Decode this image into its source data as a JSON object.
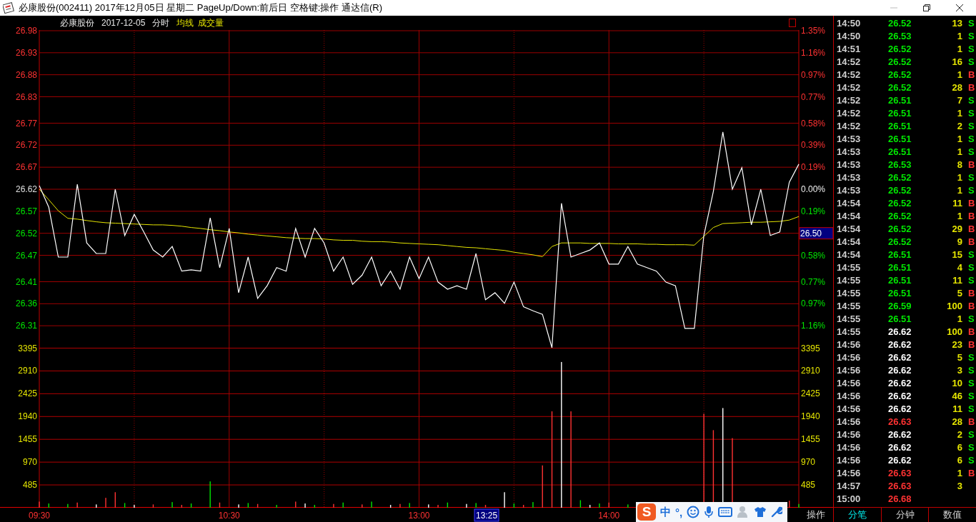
{
  "window": {
    "title": "必康股份(002411) 2017年12月05日 星期二 PageUp/Down:前后日 空格键:操作 通达信(R)"
  },
  "header": {
    "stock": "必康股份",
    "date": "2017-12-05",
    "mode": "分时",
    "indicators": [
      "均线",
      "成交量"
    ]
  },
  "price_chart": {
    "chart_data": {
      "type": "line",
      "grid": true,
      "categories": [
        null,
        null,
        null,
        null,
        null,
        null,
        null,
        null,
        null,
        null,
        null,
        null,
        null,
        null,
        null,
        null,
        null,
        null,
        null,
        null,
        null,
        null,
        null,
        null,
        null,
        null,
        null,
        null,
        null,
        null,
        null,
        null,
        null,
        null,
        null,
        null,
        null,
        null,
        null,
        null,
        null,
        null,
        null,
        null,
        null,
        null,
        null,
        null,
        null,
        null,
        null,
        null,
        null,
        null,
        null,
        null,
        null,
        null,
        null,
        null,
        null,
        null,
        null,
        null,
        null,
        null,
        null,
        null,
        null,
        null,
        null,
        null,
        null,
        null,
        null,
        null,
        null,
        null,
        null,
        null,
        null
      ],
      "series": [
        {
          "color": "#ffffff",
          "values": [
            26.628,
            26.579,
            26.466,
            26.466,
            26.631,
            26.498,
            26.474,
            26.474,
            26.62,
            26.515,
            26.563,
            26.523,
            26.482,
            26.466,
            26.49,
            26.434,
            26.437,
            26.434,
            26.555,
            26.442,
            26.531,
            26.385,
            26.466,
            26.372,
            26.401,
            26.442,
            26.434,
            26.531,
            26.466,
            26.531,
            26.498,
            26.434,
            26.466,
            26.404,
            26.425,
            26.466,
            26.401,
            26.434,
            26.393,
            26.466,
            26.417,
            26.466,
            26.409,
            26.393,
            26.401,
            26.393,
            26.474,
            26.369,
            26.385,
            26.361,
            26.409,
            26.353,
            26.344,
            26.336,
            26.26,
            26.588,
            26.466,
            26.474,
            26.482,
            26.498,
            26.45,
            26.45,
            26.49,
            26.45,
            26.442,
            26.434,
            26.409,
            26.401,
            26.304,
            26.304,
            26.515,
            26.615,
            26.75,
            26.62,
            26.669,
            26.539,
            26.62,
            26.515,
            26.523,
            26.636,
            26.677
          ]
        },
        {
          "color": "#e6e600",
          "values": [
            26.62,
            26.596,
            26.571,
            26.554,
            26.552,
            26.549,
            26.546,
            26.544,
            26.543,
            26.542,
            26.541,
            26.54,
            26.539,
            26.539,
            26.538,
            26.536,
            26.533,
            26.531,
            26.528,
            26.526,
            26.523,
            26.521,
            26.518,
            26.516,
            26.514,
            26.512,
            26.51,
            26.509,
            26.508,
            26.508,
            26.507,
            26.505,
            26.504,
            26.504,
            26.502,
            26.501,
            26.501,
            26.5,
            26.498,
            26.497,
            26.496,
            26.495,
            26.494,
            26.492,
            26.49,
            26.488,
            26.487,
            26.485,
            26.483,
            26.481,
            26.477,
            26.474,
            26.471,
            26.467,
            26.49,
            26.498,
            26.498,
            26.498,
            26.497,
            26.497,
            26.497,
            26.496,
            26.496,
            26.496,
            26.495,
            26.495,
            26.494,
            26.494,
            26.494,
            26.493,
            26.513,
            26.533,
            26.542,
            26.543,
            26.544,
            26.545,
            26.545,
            26.546,
            26.547,
            26.55,
            26.558
          ]
        }
      ],
      "ylim": [
        26.26,
        26.98
      ],
      "yticks": [
        {
          "value": 26.98,
          "label": "26.98"
        },
        {
          "value": 26.93,
          "label": "26.93"
        },
        {
          "value": 26.88,
          "label": "26.88"
        },
        {
          "value": 26.83,
          "label": "26.83"
        },
        {
          "value": 26.77,
          "label": "26.77"
        },
        {
          "value": 26.72,
          "label": "26.72"
        },
        {
          "value": 26.67,
          "label": "26.67"
        },
        {
          "value": 26.62,
          "label": "26.62"
        },
        {
          "value": 26.57,
          "label": "26.57"
        },
        {
          "value": 26.52,
          "label": "26.52"
        },
        {
          "value": 26.47,
          "label": "26.47"
        },
        {
          "value": 26.41,
          "label": "26.41"
        },
        {
          "value": 26.36,
          "label": "26.36"
        },
        {
          "value": 26.31,
          "label": "26.31"
        }
      ]
    },
    "right_labels": [
      {
        "label": "1.35%",
        "kind": "up"
      },
      {
        "label": "1.16%",
        "kind": "up"
      },
      {
        "label": "0.97%",
        "kind": "up"
      },
      {
        "label": "0.77%",
        "kind": "up"
      },
      {
        "label": "0.58%",
        "kind": "up"
      },
      {
        "label": "0.39%",
        "kind": "up"
      },
      {
        "label": "0.19%",
        "kind": "up"
      },
      {
        "label": "0.00%",
        "kind": "flat"
      },
      {
        "label": "0.19%",
        "kind": "down"
      },
      {
        "label": "26.50",
        "kind": "cursor"
      },
      {
        "label": "0.58%",
        "kind": "down"
      },
      {
        "label": "0.77%",
        "kind": "down"
      },
      {
        "label": "0.97%",
        "kind": "down"
      },
      {
        "label": "1.16%",
        "kind": "down"
      }
    ]
  },
  "volume_chart": {
    "chart_data": {
      "type": "bar",
      "grid": true,
      "categories": [
        "09:30",
        null,
        null,
        null,
        null,
        null,
        null,
        null,
        null,
        null,
        null,
        null,
        null,
        null,
        null,
        null,
        null,
        null,
        null,
        null,
        "10:30",
        null,
        null,
        null,
        null,
        null,
        null,
        null,
        null,
        null,
        null,
        null,
        null,
        null,
        null,
        null,
        null,
        null,
        null,
        null,
        "13:00",
        null,
        null,
        null,
        null,
        null,
        null,
        null,
        null,
        null,
        null,
        null,
        null,
        null,
        null,
        null,
        null,
        null,
        null,
        null,
        "14:00",
        null,
        null,
        null,
        null,
        null,
        null,
        null,
        null,
        null,
        null,
        null,
        null,
        null,
        null,
        null,
        null,
        null,
        null,
        null,
        null
      ],
      "series": [
        {
          "color": "#ff3232",
          "values": [
            130,
            null,
            null,
            null,
            110,
            null,
            null,
            210,
            330,
            null,
            null,
            null,
            70,
            null,
            null,
            60,
            null,
            null,
            null,
            110,
            null,
            null,
            null,
            80,
            null,
            null,
            null,
            130,
            null,
            null,
            null,
            80,
            null,
            null,
            70,
            null,
            null,
            null,
            80,
            null,
            null,
            null,
            60,
            null,
            null,
            null,
            null,
            60,
            null,
            null,
            null,
            60,
            null,
            900,
            2050,
            null,
            2050,
            null,
            null,
            null,
            110,
            null,
            null,
            null,
            null,
            null,
            null,
            null,
            null,
            null,
            2000,
            1650,
            null,
            1480,
            null,
            null,
            null,
            null,
            null,
            150,
            null
          ]
        },
        {
          "color": "#00e600",
          "values": [
            null,
            90,
            null,
            80,
            null,
            null,
            null,
            null,
            null,
            100,
            null,
            null,
            null,
            null,
            120,
            null,
            90,
            null,
            560,
            null,
            null,
            null,
            100,
            null,
            null,
            60,
            null,
            null,
            null,
            60,
            null,
            null,
            110,
            null,
            null,
            130,
            null,
            null,
            null,
            100,
            null,
            null,
            null,
            110,
            null,
            null,
            100,
            null,
            null,
            null,
            90,
            null,
            120,
            null,
            null,
            null,
            null,
            160,
            null,
            90,
            null,
            null,
            70,
            null,
            null,
            null,
            null,
            null,
            null,
            null,
            null,
            null,
            null,
            null,
            null,
            null,
            null,
            null,
            null,
            null,
            80
          ]
        },
        {
          "color": "#ffffff",
          "values": [
            null,
            null,
            null,
            null,
            null,
            null,
            70,
            null,
            null,
            null,
            60,
            null,
            null,
            null,
            null,
            null,
            null,
            null,
            null,
            null,
            null,
            70,
            null,
            null,
            null,
            null,
            null,
            null,
            90,
            null,
            null,
            null,
            null,
            null,
            null,
            null,
            null,
            60,
            null,
            null,
            null,
            70,
            null,
            null,
            null,
            80,
            null,
            null,
            null,
            330,
            null,
            null,
            null,
            null,
            null,
            3100,
            null,
            null,
            60,
            null,
            null,
            null,
            null,
            null,
            null,
            null,
            null,
            null,
            null,
            null,
            null,
            null,
            2120,
            null,
            null,
            null,
            null,
            null,
            null,
            null,
            null
          ]
        }
      ],
      "ylim": [
        0,
        3395
      ],
      "yticks": [
        {
          "value": 3395,
          "label": "3395"
        },
        {
          "value": 2910,
          "label": "2910"
        },
        {
          "value": 2425,
          "label": "2425"
        },
        {
          "value": 1940,
          "label": "1940"
        },
        {
          "value": 1455,
          "label": "1455"
        },
        {
          "value": 970,
          "label": "970"
        },
        {
          "value": 485,
          "label": "485"
        }
      ]
    }
  },
  "time_cursor": "13:25",
  "operate_button": "操作",
  "ime_toolbar": {
    "logo": "S",
    "mode": "中",
    "punctuation": "°,"
  },
  "ticks": [
    {
      "time": "14:50",
      "price": "26.52",
      "volume": "13",
      "side": "S",
      "color": "#00e600",
      "buy": false
    },
    {
      "time": "14:50",
      "price": "26.53",
      "volume": "1",
      "side": "S",
      "color": "#00e600",
      "buy": false
    },
    {
      "time": "14:51",
      "price": "26.52",
      "volume": "1",
      "side": "S",
      "color": "#00e600",
      "buy": false
    },
    {
      "time": "14:52",
      "price": "26.52",
      "volume": "16",
      "side": "S",
      "color": "#00e600",
      "buy": false
    },
    {
      "time": "14:52",
      "price": "26.52",
      "volume": "1",
      "side": "B",
      "color": "#00e600",
      "buy": true
    },
    {
      "time": "14:52",
      "price": "26.52",
      "volume": "28",
      "side": "B",
      "color": "#00e600",
      "buy": true
    },
    {
      "time": "14:52",
      "price": "26.51",
      "volume": "7",
      "side": "S",
      "color": "#00e600",
      "buy": false
    },
    {
      "time": "14:52",
      "price": "26.51",
      "volume": "1",
      "side": "S",
      "color": "#00e600",
      "buy": false
    },
    {
      "time": "14:52",
      "price": "26.51",
      "volume": "2",
      "side": "S",
      "color": "#00e600",
      "buy": false
    },
    {
      "time": "14:53",
      "price": "26.51",
      "volume": "1",
      "side": "S",
      "color": "#00e600",
      "buy": false
    },
    {
      "time": "14:53",
      "price": "26.51",
      "volume": "1",
      "side": "S",
      "color": "#00e600",
      "buy": false
    },
    {
      "time": "14:53",
      "price": "26.53",
      "volume": "8",
      "side": "B",
      "color": "#00e600",
      "buy": true
    },
    {
      "time": "14:53",
      "price": "26.52",
      "volume": "1",
      "side": "S",
      "color": "#00e600",
      "buy": false
    },
    {
      "time": "14:53",
      "price": "26.52",
      "volume": "1",
      "side": "S",
      "color": "#00e600",
      "buy": false
    },
    {
      "time": "14:54",
      "price": "26.52",
      "volume": "11",
      "side": "B",
      "color": "#00e600",
      "buy": true
    },
    {
      "time": "14:54",
      "price": "26.52",
      "volume": "1",
      "side": "B",
      "color": "#00e600",
      "buy": true
    },
    {
      "time": "14:54",
      "price": "26.52",
      "volume": "29",
      "side": "B",
      "color": "#00e600",
      "buy": true
    },
    {
      "time": "14:54",
      "price": "26.52",
      "volume": "9",
      "side": "B",
      "color": "#00e600",
      "buy": true
    },
    {
      "time": "14:54",
      "price": "26.51",
      "volume": "15",
      "side": "S",
      "color": "#00e600",
      "buy": false
    },
    {
      "time": "14:55",
      "price": "26.51",
      "volume": "4",
      "side": "S",
      "color": "#00e600",
      "buy": false
    },
    {
      "time": "14:55",
      "price": "26.51",
      "volume": "11",
      "side": "S",
      "color": "#00e600",
      "buy": false
    },
    {
      "time": "14:55",
      "price": "26.51",
      "volume": "5",
      "side": "B",
      "color": "#00e600",
      "buy": true
    },
    {
      "time": "14:55",
      "price": "26.59",
      "volume": "100",
      "side": "B",
      "color": "#00e600",
      "buy": true
    },
    {
      "time": "14:55",
      "price": "26.51",
      "volume": "1",
      "side": "S",
      "color": "#00e600",
      "buy": false
    },
    {
      "time": "14:55",
      "price": "26.62",
      "volume": "100",
      "side": "B",
      "color": "#ffffff",
      "buy": true
    },
    {
      "time": "14:56",
      "price": "26.62",
      "volume": "23",
      "side": "B",
      "color": "#ffffff",
      "buy": true
    },
    {
      "time": "14:56",
      "price": "26.62",
      "volume": "5",
      "side": "S",
      "color": "#ffffff",
      "buy": false
    },
    {
      "time": "14:56",
      "price": "26.62",
      "volume": "3",
      "side": "S",
      "color": "#ffffff",
      "buy": false
    },
    {
      "time": "14:56",
      "price": "26.62",
      "volume": "10",
      "side": "S",
      "color": "#ffffff",
      "buy": false
    },
    {
      "time": "14:56",
      "price": "26.62",
      "volume": "46",
      "side": "S",
      "color": "#ffffff",
      "buy": false
    },
    {
      "time": "14:56",
      "price": "26.62",
      "volume": "11",
      "side": "S",
      "color": "#ffffff",
      "buy": false
    },
    {
      "time": "14:56",
      "price": "26.63",
      "volume": "28",
      "side": "B",
      "color": "#ff3232",
      "buy": true
    },
    {
      "time": "14:56",
      "price": "26.62",
      "volume": "2",
      "side": "S",
      "color": "#ffffff",
      "buy": false
    },
    {
      "time": "14:56",
      "price": "26.62",
      "volume": "6",
      "side": "S",
      "color": "#ffffff",
      "buy": false
    },
    {
      "time": "14:56",
      "price": "26.62",
      "volume": "6",
      "side": "S",
      "color": "#ffffff",
      "buy": false
    },
    {
      "time": "14:56",
      "price": "26.63",
      "volume": "1",
      "side": "B",
      "color": "#ff3232",
      "buy": true
    },
    {
      "time": "14:57",
      "price": "26.63",
      "volume": "3",
      "color": "#ff3232"
    },
    {
      "time": "15:00",
      "price": "26.68",
      "color": "#ff3232"
    }
  ],
  "tabs": [
    {
      "label": "分笔",
      "selected": true
    },
    {
      "label": "分钟",
      "selected": false
    },
    {
      "label": "数值",
      "selected": false
    }
  ]
}
